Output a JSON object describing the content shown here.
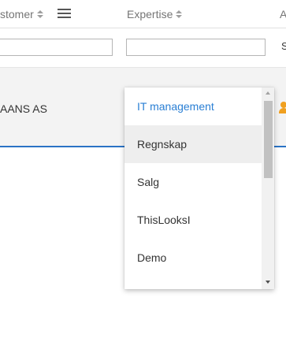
{
  "header": {
    "customer_label": "stomer",
    "expertise_label": "Expertise",
    "next_col_label": "A"
  },
  "filters": {
    "customer_value": "",
    "expertise_value": "",
    "next_letter": "S"
  },
  "row": {
    "customer": "AANS AS"
  },
  "dropdown": {
    "options": [
      {
        "label": "IT management",
        "state": "selected"
      },
      {
        "label": "Regnskap",
        "state": "highlighted"
      },
      {
        "label": "Salg",
        "state": ""
      },
      {
        "label": "ThisLooksI",
        "state": ""
      },
      {
        "label": "Demo",
        "state": ""
      }
    ]
  },
  "colors": {
    "accent": "#2a7fd4",
    "row_border": "#2a73c5",
    "person_icon": "#f0a020"
  },
  "icons": {
    "menu": "hamburger-menu-icon",
    "sort": "sort-icon",
    "person": "person-icon"
  }
}
